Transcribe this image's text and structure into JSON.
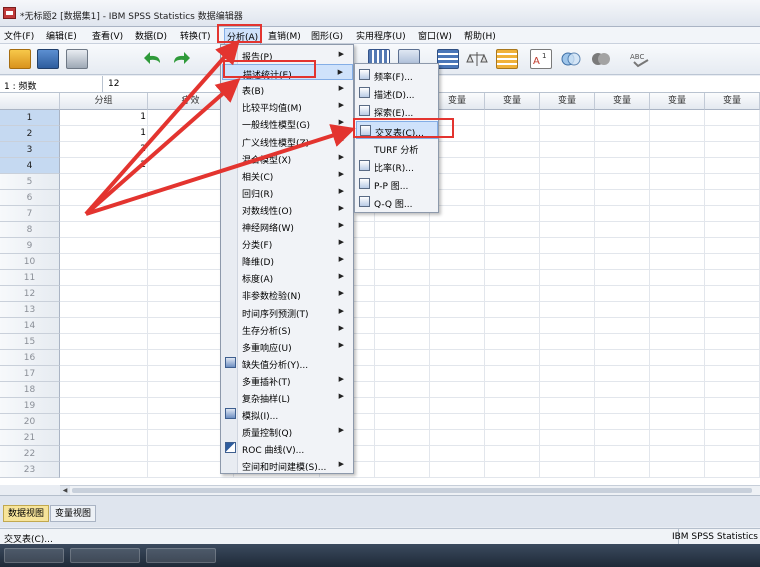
{
  "window": {
    "title": "*无标题2 [数据集1] - IBM SPSS Statistics 数据编辑器"
  },
  "menubar": [
    "文件(F)",
    "编辑(E)",
    "查看(V)",
    "数据(D)",
    "转换(T)",
    "分析(A)",
    "直销(M)",
    "图形(G)",
    "实用程序(U)",
    "窗口(W)",
    "帮助(H)"
  ],
  "toolbar_icons": [
    "open-folder-icon",
    "save-icon",
    "print-icon",
    "undo-icon",
    "redo-icon",
    "chart-builder-icon",
    "insert-cases-icon",
    "split-file-icon",
    "weight-cases-icon",
    "select-cases-icon",
    "value-labels-icon",
    "use-sets-icon",
    "show-sets-icon",
    "spell-check-icon"
  ],
  "cellbar": {
    "ref": "1 : 频数",
    "value": "12"
  },
  "grid": {
    "columns": [
      "分组",
      "疗效",
      "变量",
      "变量",
      "变量",
      "变量",
      "变量",
      "变量",
      "变量",
      "变量"
    ],
    "row_numbers": [
      "1",
      "2",
      "3",
      "4",
      "5",
      "6",
      "7",
      "8",
      "9",
      "10",
      "11",
      "12",
      "13",
      "14",
      "15",
      "16",
      "17",
      "18",
      "19",
      "20",
      "21",
      "22",
      "23"
    ],
    "group_values": [
      "1",
      "1",
      "2",
      "2"
    ]
  },
  "analyze_menu": [
    {
      "label": "报告(P)",
      "arrow": true
    },
    {
      "label": "描述统计(E)",
      "arrow": true,
      "highlight": true
    },
    {
      "label": "表(B)",
      "arrow": true
    },
    {
      "label": "比较平均值(M)",
      "arrow": true
    },
    {
      "label": "一般线性模型(G)",
      "arrow": true
    },
    {
      "label": "广义线性模型(Z)",
      "arrow": true
    },
    {
      "label": "混合模型(X)",
      "arrow": true
    },
    {
      "label": "相关(C)",
      "arrow": true
    },
    {
      "label": "回归(R)",
      "arrow": true
    },
    {
      "label": "对数线性(O)",
      "arrow": true
    },
    {
      "label": "神经网络(W)",
      "arrow": true
    },
    {
      "label": "分类(F)",
      "arrow": true
    },
    {
      "label": "降维(D)",
      "arrow": true
    },
    {
      "label": "标度(A)",
      "arrow": true
    },
    {
      "label": "非参数检验(N)",
      "arrow": true
    },
    {
      "label": "时间序列预测(T)",
      "arrow": true
    },
    {
      "label": "生存分析(S)",
      "arrow": true
    },
    {
      "label": "多重响应(U)",
      "arrow": true
    },
    {
      "label": "缺失值分析(Y)...",
      "arrow": false,
      "icon": "missing-values-icon"
    },
    {
      "label": "多重插补(T)",
      "arrow": true
    },
    {
      "label": "复杂抽样(L)",
      "arrow": true
    },
    {
      "label": "模拟(I)...",
      "arrow": false,
      "icon": "simulation-icon"
    },
    {
      "label": "质量控制(Q)",
      "arrow": true
    },
    {
      "label": "ROC 曲线(V)...",
      "arrow": false,
      "icon": "roc-curve-icon"
    },
    {
      "label": "空间和时间建模(S)...",
      "arrow": true
    }
  ],
  "descriptive_menu": [
    {
      "label": "频率(F)...",
      "icon": "frequencies-icon"
    },
    {
      "label": "描述(D)...",
      "icon": "descriptives-icon"
    },
    {
      "label": "探索(E)...",
      "icon": "explore-icon"
    },
    {
      "label": "交叉表(C)...",
      "icon": "crosstabs-icon",
      "highlight": true
    },
    {
      "label": "TURF 分析",
      "icon": ""
    },
    {
      "label": "比率(R)...",
      "icon": "ratio-icon"
    },
    {
      "label": "P-P 图...",
      "icon": "pp-plot-icon"
    },
    {
      "label": "Q-Q 图...",
      "icon": "qq-plot-icon"
    }
  ],
  "tabs": {
    "data_view": "数据视图",
    "variable_view": "变量视图"
  },
  "status": {
    "left": "交叉表(C)...",
    "right": "IBM SPSS Statistics"
  },
  "colors": {
    "annotation_red": "#e3342f",
    "highlight_blue": "#cfe2fb",
    "active_tab": "#f7e49a"
  }
}
